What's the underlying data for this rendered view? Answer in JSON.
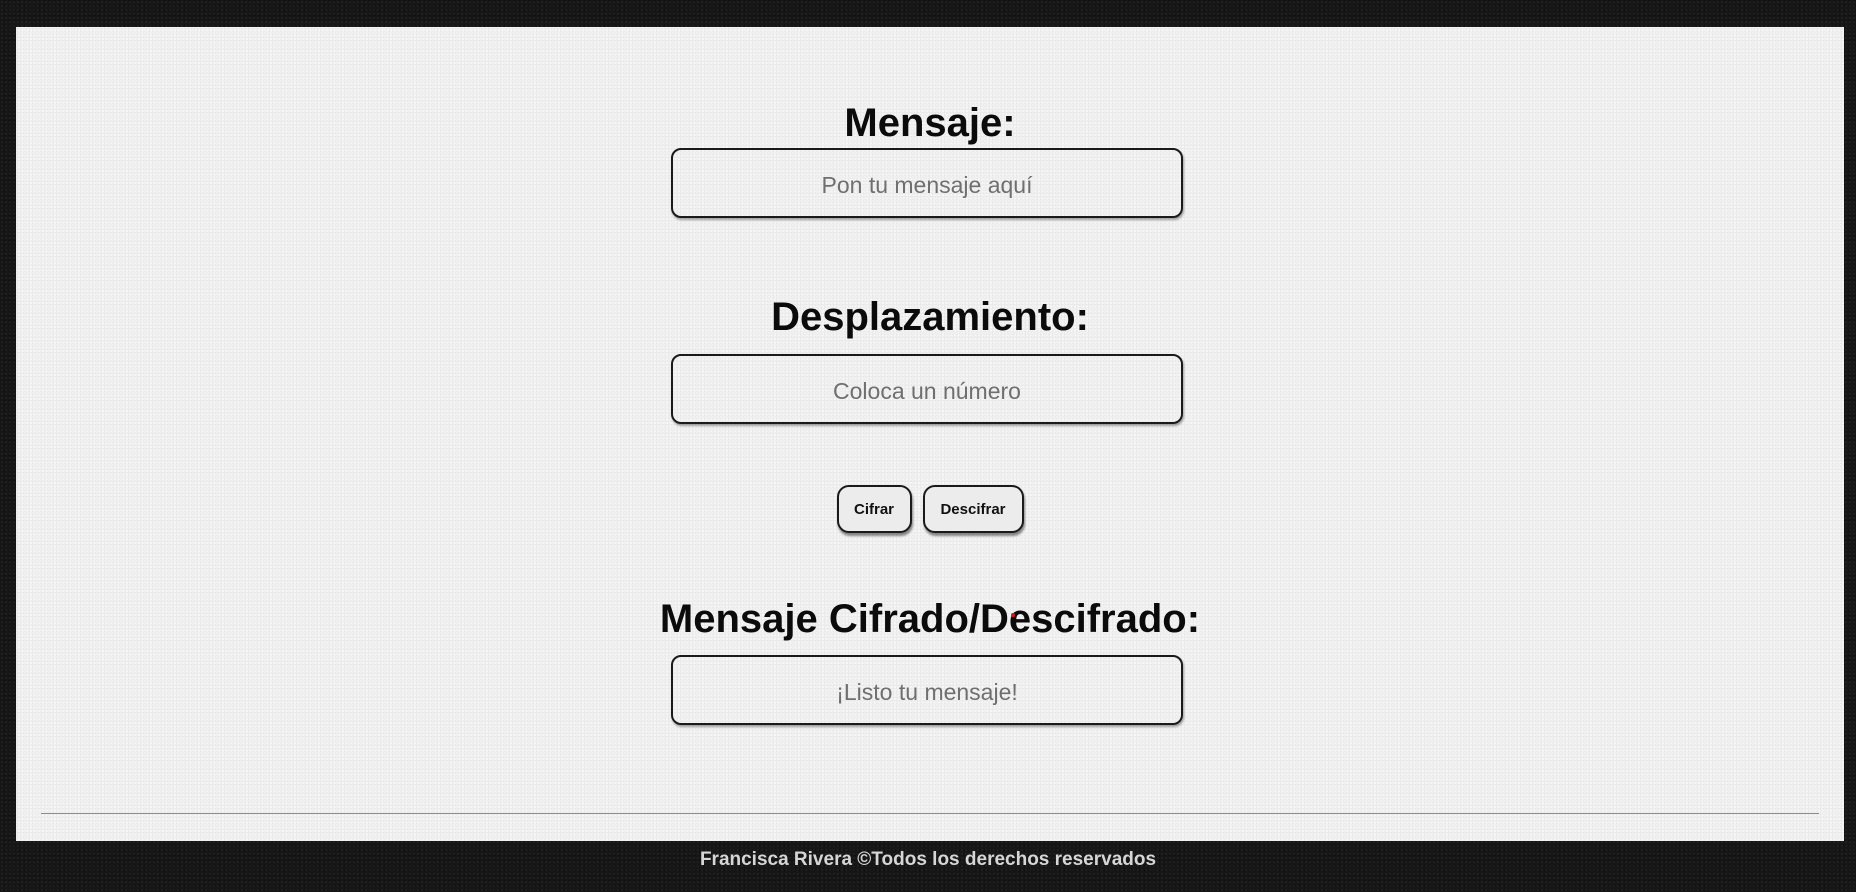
{
  "message_section": {
    "heading": "Mensaje:",
    "placeholder": "Pon tu mensaje aquí",
    "value": ""
  },
  "shift_section": {
    "heading": "Desplazamiento:",
    "placeholder": "Coloca un número",
    "value": ""
  },
  "actions": {
    "encrypt_label": "Cifrar",
    "decrypt_label": "Descifrar"
  },
  "result_section": {
    "heading": "Mensaje Cifrado/Descifrado:",
    "placeholder": "¡Listo tu mensaje!",
    "value": ""
  },
  "footer": {
    "text": "Francisca Rivera ©Todos los derechos reservados"
  },
  "colors": {
    "page_background": "#161616",
    "panel_background": "#f1f1f1",
    "text": "#0b0b0b",
    "footer_text": "#d6d6d6"
  }
}
